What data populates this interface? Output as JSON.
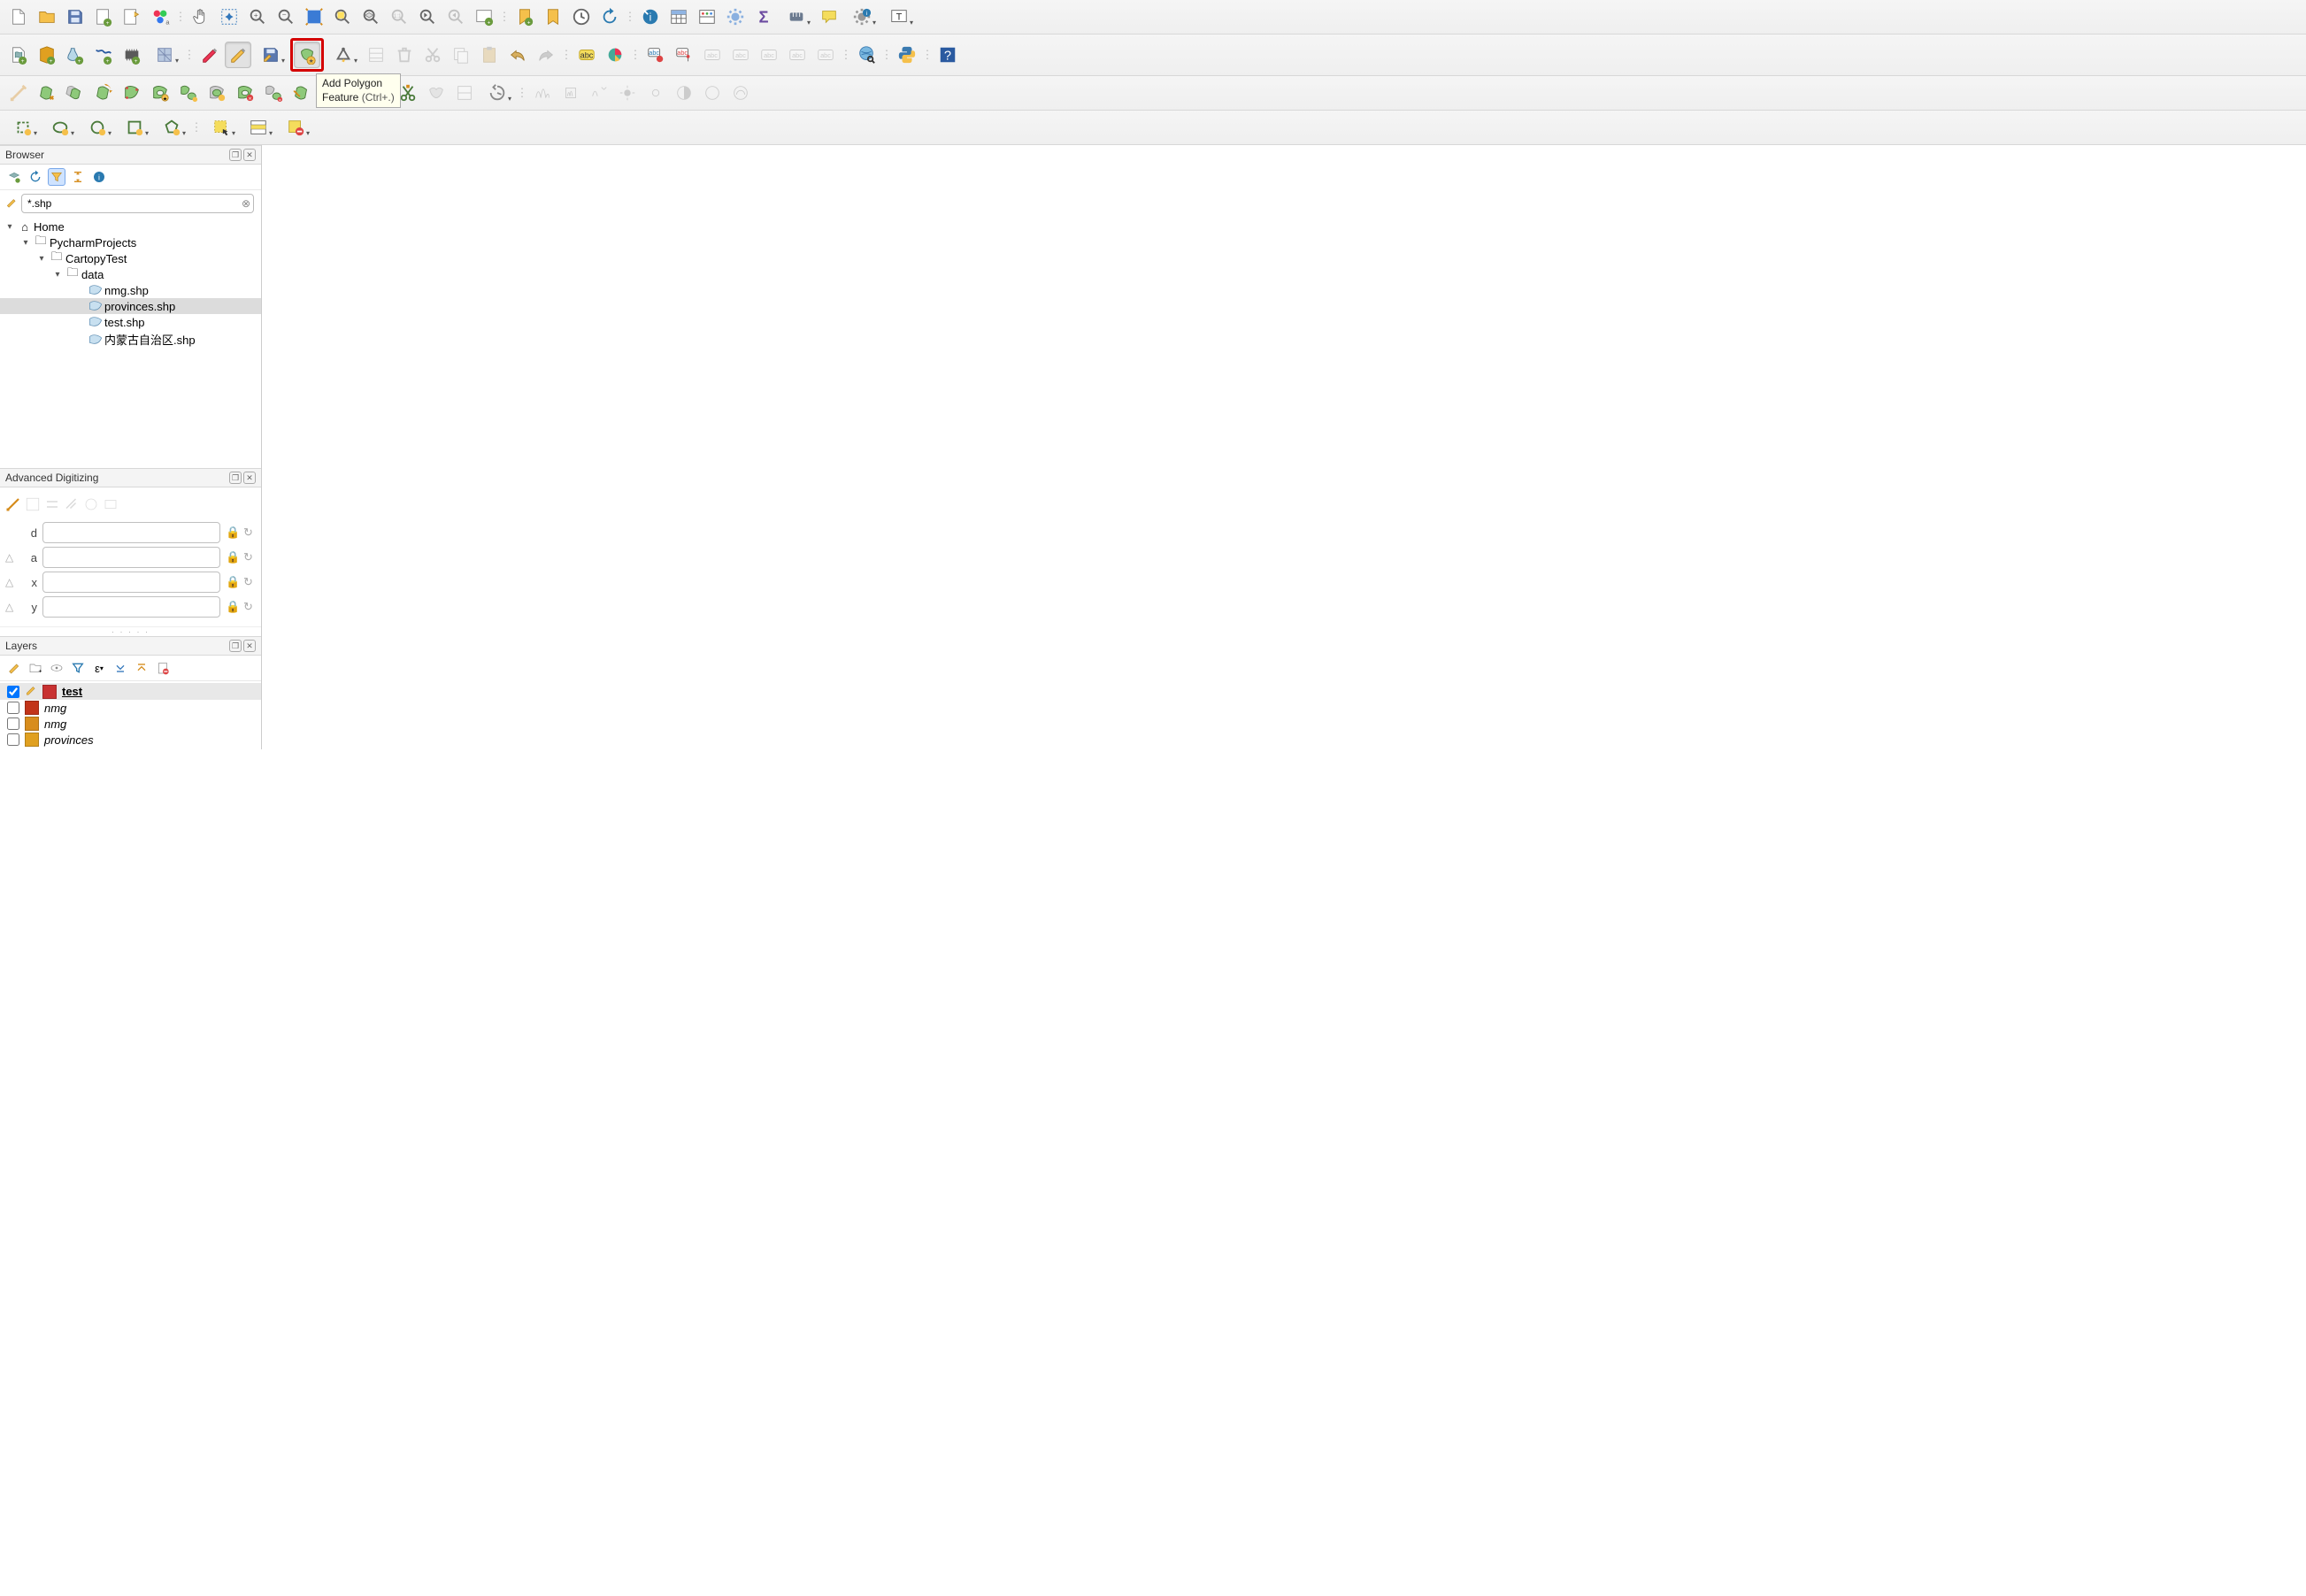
{
  "tooltip": {
    "title": "Add Polygon",
    "line2": "Feature",
    "shortcut": "(Ctrl+.)"
  },
  "panels": {
    "browser": {
      "title": "Browser",
      "search_value": "*.shp",
      "tree": {
        "home": "Home",
        "pycharm": "PycharmProjects",
        "cartopy": "CartopyTest",
        "data": "data",
        "files": [
          "nmg.shp",
          "provinces.shp",
          "test.shp",
          "内蒙古自治区.shp"
        ],
        "selected_index": 1
      }
    },
    "adv": {
      "title": "Advanced Digitizing",
      "fields": [
        {
          "label": "d",
          "value": ""
        },
        {
          "label": "a",
          "value": ""
        },
        {
          "label": "x",
          "value": ""
        },
        {
          "label": "y",
          "value": ""
        }
      ]
    },
    "layers": {
      "title": "Layers",
      "items": [
        {
          "name": "test",
          "checked": true,
          "editable": true,
          "italic": false,
          "swatch": "#c83232"
        },
        {
          "name": "nmg",
          "checked": false,
          "editable": false,
          "italic": true,
          "swatch": "#c23419"
        },
        {
          "name": "nmg",
          "checked": false,
          "editable": false,
          "italic": true,
          "swatch": "#d88d1d"
        },
        {
          "name": "provinces",
          "checked": false,
          "editable": false,
          "italic": true,
          "swatch": "#e0a020"
        }
      ]
    }
  }
}
